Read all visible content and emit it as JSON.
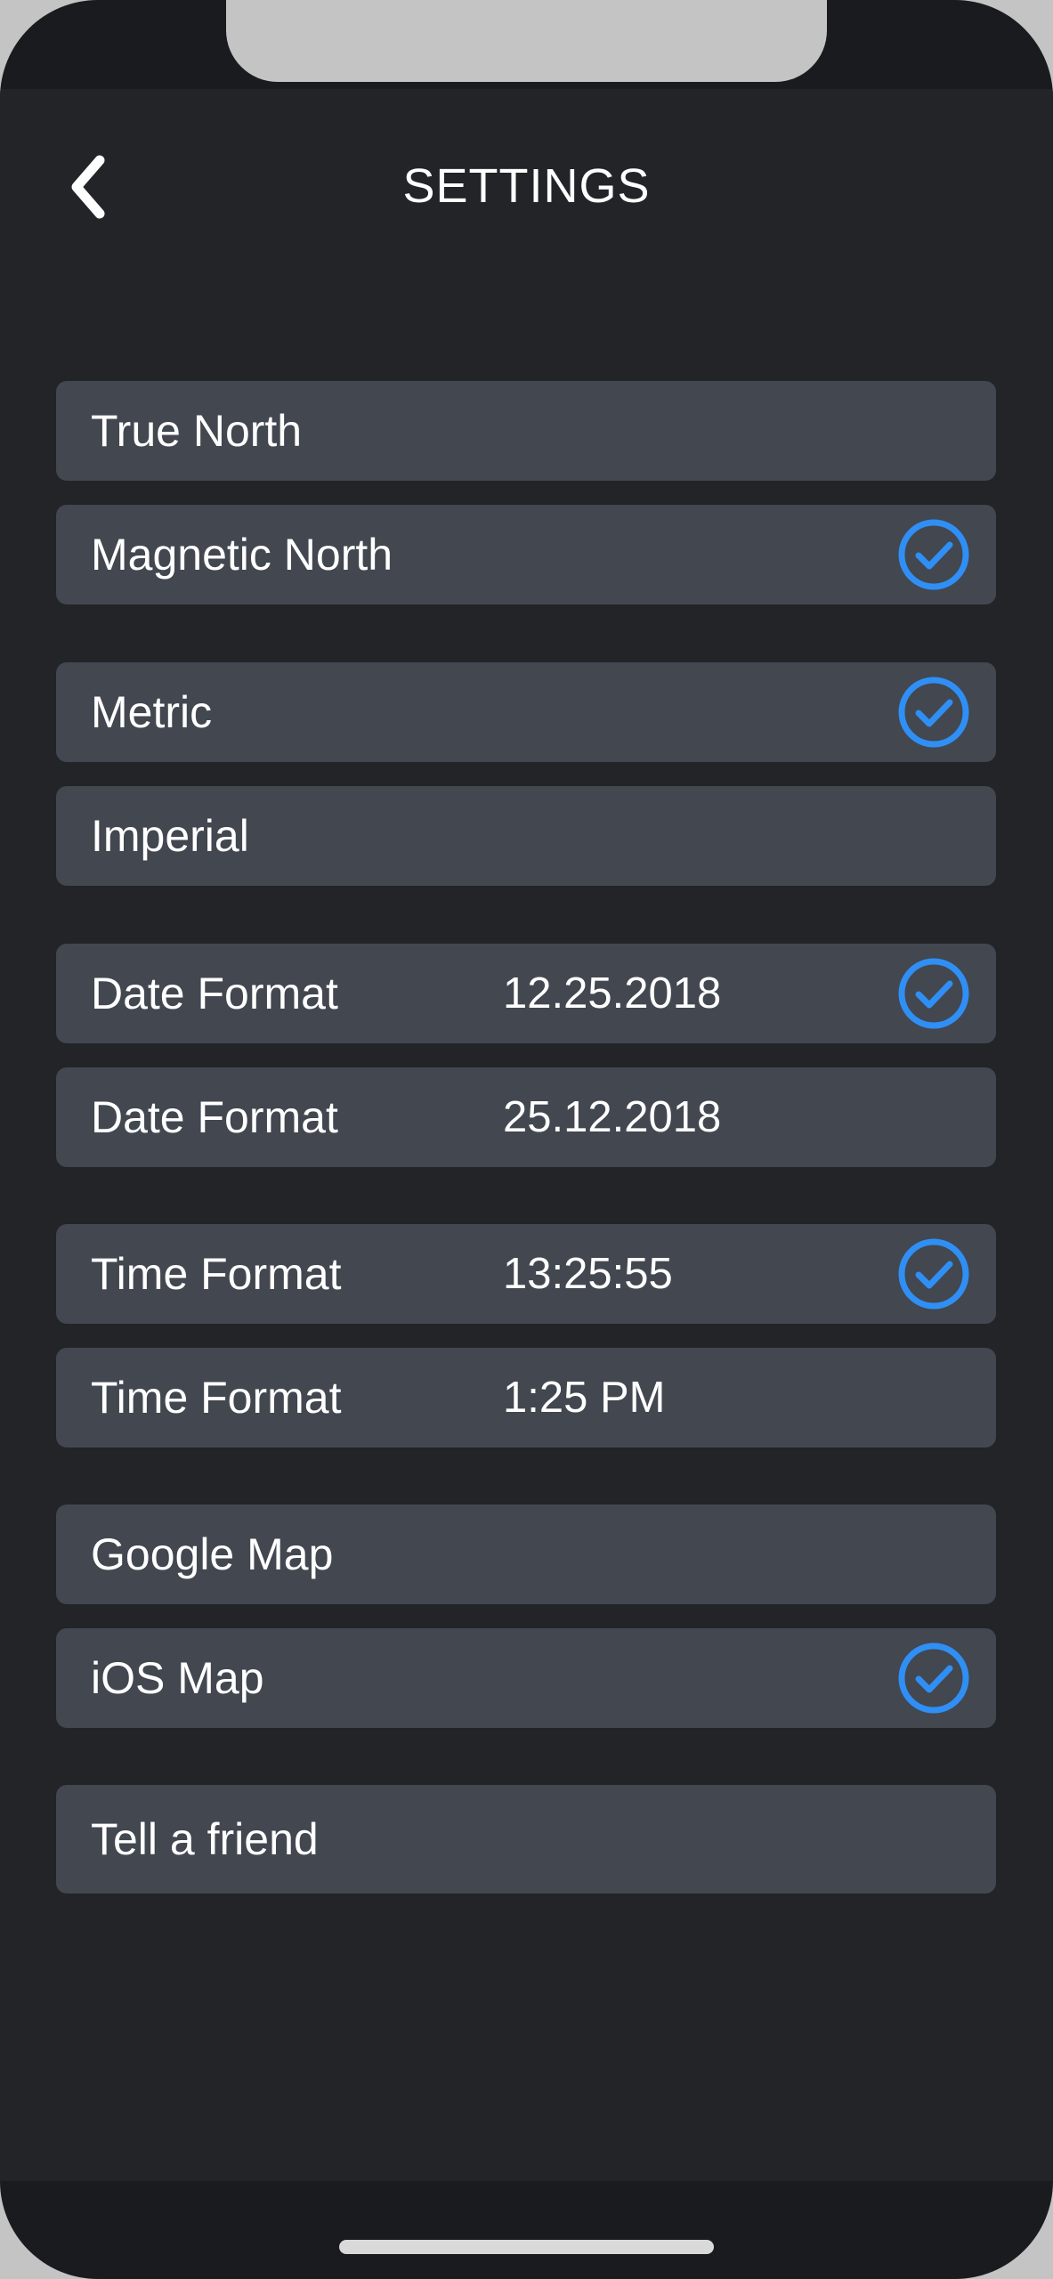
{
  "header": {
    "title": "SETTINGS"
  },
  "rows": [
    {
      "label": "True North",
      "value": "",
      "checked": false
    },
    {
      "label": "Magnetic North",
      "value": "",
      "checked": true
    },
    {
      "label": "Metric",
      "value": "",
      "checked": true
    },
    {
      "label": "Imperial",
      "value": "",
      "checked": false
    },
    {
      "label": "Date Format",
      "value": "12.25.2018",
      "checked": true
    },
    {
      "label": "Date Format",
      "value": "25.12.2018",
      "checked": false
    },
    {
      "label": "Time Format",
      "value": "13:25:55",
      "checked": true
    },
    {
      "label": "Time Format",
      "value": "1:25 PM",
      "checked": false
    },
    {
      "label": "Google Map",
      "value": "",
      "checked": false
    },
    {
      "label": "iOS Map",
      "value": "",
      "checked": true
    },
    {
      "label": "Tell a friend",
      "value": "",
      "checked": false
    }
  ],
  "icons": {
    "back": "chevron-left-icon",
    "check": "check-circle-icon"
  },
  "colors": {
    "background": "#232428",
    "row": "#424750",
    "accent": "#2f8ff5",
    "text": "#ffffff"
  }
}
